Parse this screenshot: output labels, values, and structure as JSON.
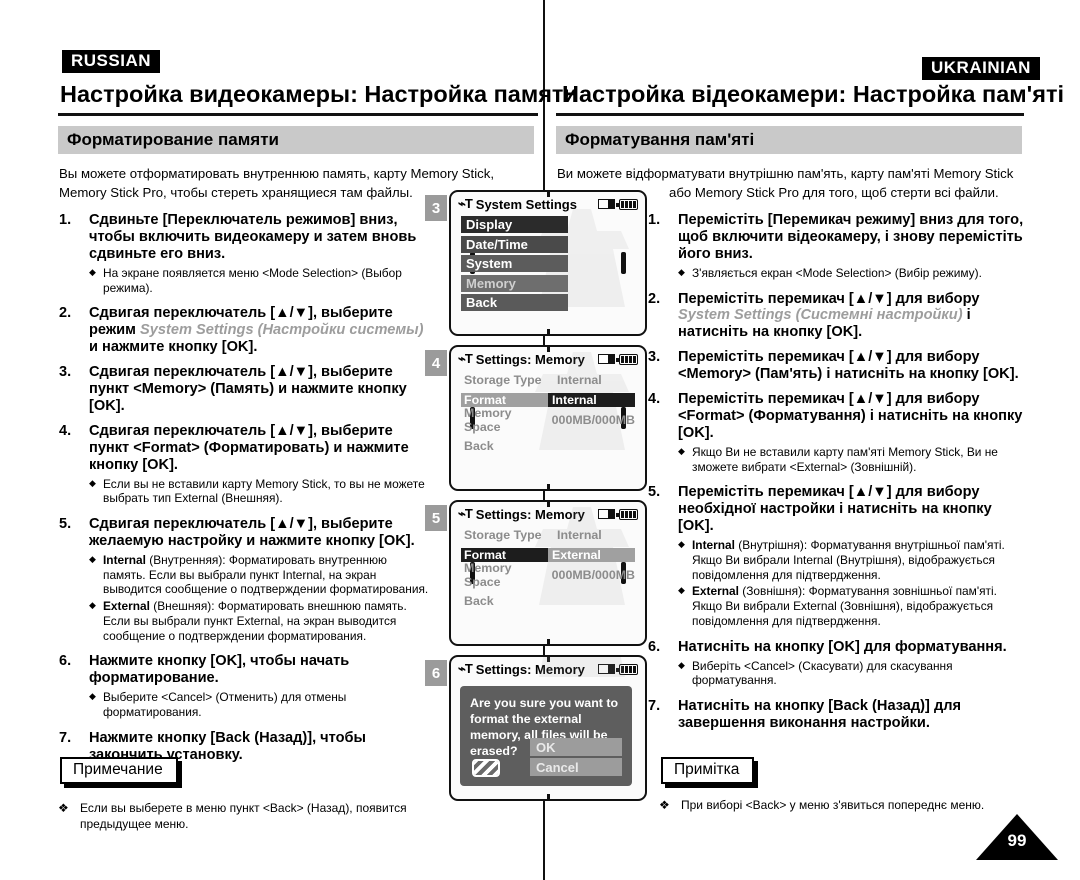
{
  "divider": true,
  "left": {
    "lang_tag": "RUSSIAN",
    "chapter_title": "Настройка видеокамеры: Настройка памяти",
    "section_title": "Форматирование памяти",
    "intro_line1": "Вы можете отформатировать внутреннюю память, карту Memory Stick,",
    "intro_line2": "Memory Stick Pro, чтобы стереть хранящиеся там файлы.",
    "steps": [
      {
        "num": "1.",
        "text_pre": "Сдвиньте [Переключатель режимов] вниз, чтобы включить видеокамеру и затем вновь сдвиньте его вниз.",
        "text_italic": "",
        "text_post": "",
        "bullets": [
          {
            "bold": "",
            "text": "На экране появляется меню <Mode Selection> (Выбор режима)."
          }
        ]
      },
      {
        "num": "2.",
        "text_pre": "Сдвигая переключатель [▲/▼], выберите режим ",
        "text_italic": "System Settings (Настройки системы)",
        "text_post": " и нажмите кнопку [OK].",
        "bullets": []
      },
      {
        "num": "3.",
        "text_pre": "Сдвигая переключатель [▲/▼], выберите пункт <Memory> (Память) и нажмите кнопку [OK].",
        "text_italic": "",
        "text_post": "",
        "bullets": []
      },
      {
        "num": "4.",
        "text_pre": "Сдвигая переключатель [▲/▼], выберите пункт <Format> (Форматировать) и нажмите кнопку [OK].",
        "text_italic": "",
        "text_post": "",
        "bullets": [
          {
            "bold": "",
            "text": "Если вы не вставили карту Memory Stick, то вы не можете выбрать тип External (Внешняя)."
          }
        ]
      },
      {
        "num": "5.",
        "text_pre": "Сдвигая переключатель [▲/▼], выберите желаемую настройку и нажмите кнопку [OK].",
        "text_italic": "",
        "text_post": "",
        "bullets": [
          {
            "bold": "Internal",
            "text": " (Внутренняя): Форматировать внутреннюю память. Если вы выбрали пункт Internal, на экран выводится сообщение о подтверждении форматирования."
          },
          {
            "bold": "External",
            "text": " (Внешняя): Форматировать внешнюю память. Если вы выбрали пункт External, на экран выводится сообщение о подтверждении форматирования."
          }
        ]
      },
      {
        "num": "6.",
        "text_pre": "Нажмите кнопку [OK], чтобы начать форматирование.",
        "text_italic": "",
        "text_post": "",
        "bullets": [
          {
            "bold": "",
            "text": "Выберите <Cancel> (Отменить) для отмены форматирования."
          }
        ]
      },
      {
        "num": "7.",
        "text_pre": "Нажмите кнопку [Back (Назад)], чтобы закончить установку.",
        "text_italic": "",
        "text_post": "",
        "bullets": []
      }
    ],
    "note_label": "Примечание",
    "note_symbol": "❖",
    "note_text": "Если вы выберете в меню пункт <Back> (Назад), появится предыдущее меню."
  },
  "right": {
    "lang_tag": "UKRAINIAN",
    "chapter_title": "Настройка відеокамери: Настройка пам'яті",
    "section_title": "Форматування пам'яті",
    "intro_line1": "Ви можете відформатувати внутрішню пам'ять, карту пам'яті Memory Stick",
    "intro_line2": "або Memory Stick Pro для того, щоб стерти всі файли.",
    "steps": [
      {
        "num": "1.",
        "text_pre": "Перемістіть [Перемикач режиму] вниз для того, щоб включити відеокамеру, і знову перемістіть його вниз.",
        "text_italic": "",
        "text_post": "",
        "bullets": [
          {
            "bold": "",
            "text": "З'являється екран <Mode Selection> (Вибір режиму)."
          }
        ]
      },
      {
        "num": "2.",
        "text_pre": "Перемістіть перемикач [▲/▼] для вибору ",
        "text_italic": "System Settings (Системні настройки)",
        "text_post": " і натисніть на кнопку [OK].",
        "bullets": []
      },
      {
        "num": "3.",
        "text_pre": "Перемістіть перемикач [▲/▼] для вибору <Memory> (Пам'ять) і натисніть на кнопку [OK].",
        "text_italic": "",
        "text_post": "",
        "bullets": []
      },
      {
        "num": "4.",
        "text_pre": "Перемістіть перемикач [▲/▼] для вибору <Format> (Форматування) і натисніть на кнопку [OK].",
        "text_italic": "",
        "text_post": "",
        "bullets": [
          {
            "bold": "",
            "text": "Якщо Ви не вставили карту пам'яті Memory Stick, Ви не зможете вибрати <External> (Зовнішній)."
          }
        ]
      },
      {
        "num": "5.",
        "text_pre": "Перемістіть перемикач [▲/▼] для вибору необхідної настройки і натисніть на кнопку [OK].",
        "text_italic": "",
        "text_post": "",
        "bullets": [
          {
            "bold": "Internal",
            "text": " (Внутрішня): Форматування внутрішньої пам'яті. Якщо Ви вибрали Internal (Внутрішня), відображується повідомлення для підтвердження."
          },
          {
            "bold": "External",
            "text": " (Зовнішня): Форматування зовнішньої пам'яті. Якщо Ви вибрали External (Зовнішня), відображується повідомлення для підтвердження."
          }
        ]
      },
      {
        "num": "6.",
        "text_pre": "Натисніть на кнопку [OK] для форматування.",
        "text_italic": "",
        "text_post": "",
        "bullets": [
          {
            "bold": "",
            "text": "Виберіть <Cancel> (Скасувати) для скасування форматування."
          }
        ]
      },
      {
        "num": "7.",
        "text_pre": "Натисніть на кнопку [Back (Назад)] для завершення виконання настройки.",
        "text_italic": "",
        "text_post": "",
        "bullets": []
      }
    ],
    "note_label": "Примітка",
    "note_symbol": "❖",
    "note_text": "При виборі <Back> у меню з'явиться попереднє меню."
  },
  "lcd_screens": [
    {
      "badge": "3",
      "header_title": "System Settings",
      "header_tool_icon": "tool-icon",
      "card_icon": "memory-card-icon",
      "battery_icon": "battery-icon",
      "kind": "menu",
      "menu_items": [
        {
          "label": "Display",
          "bg": "#2b2b2b",
          "fg": "#ffffff"
        },
        {
          "label": "Date/Time",
          "bg": "#4a4a4a",
          "fg": "#ffffff"
        },
        {
          "label": "System",
          "bg": "#5c5c5c",
          "fg": "#ffffff"
        },
        {
          "label": "Memory",
          "bg": "#6e6e6e",
          "fg": "#cfcfcf"
        },
        {
          "label": "Back",
          "bg": "#5a5a5a",
          "fg": "#ffffff"
        }
      ]
    },
    {
      "badge": "4",
      "header_title": "Settings: Memory",
      "header_tool_icon": "tool-icon",
      "card_icon": "memory-card-icon",
      "battery_icon": "battery-icon",
      "kind": "settings",
      "rows": [
        {
          "label": "Storage Type",
          "value": "Internal",
          "state": "normal"
        },
        {
          "label": "Format",
          "value": "Internal",
          "state": "selected-value"
        },
        {
          "label": "Memory Space",
          "value": "000MB/000MB",
          "state": "normal"
        },
        {
          "label": "Back",
          "value": "",
          "state": "normal"
        }
      ]
    },
    {
      "badge": "5",
      "header_title": "Settings: Memory",
      "header_tool_icon": "tool-icon",
      "card_icon": "memory-card-icon",
      "battery_icon": "battery-icon",
      "kind": "settings",
      "rows": [
        {
          "label": "Storage Type",
          "value": "Internal",
          "state": "normal"
        },
        {
          "label": "Format",
          "value": "External",
          "state": "selected-label"
        },
        {
          "label": "Memory Space",
          "value": "000MB/000MB",
          "state": "normal"
        },
        {
          "label": "Back",
          "value": "",
          "state": "normal"
        }
      ]
    },
    {
      "badge": "6",
      "header_title": "Settings: Memory",
      "header_tool_icon": "tool-icon",
      "card_icon": "memory-card-icon",
      "battery_icon": "battery-icon",
      "kind": "dialog",
      "dialog_text": "Are you sure you want to format the external memory, all files will be erased?",
      "dialog_warning_icon": "warning-hatched-icon",
      "dialog_buttons": [
        "OK",
        "Cancel"
      ]
    }
  ],
  "page_number": "99"
}
